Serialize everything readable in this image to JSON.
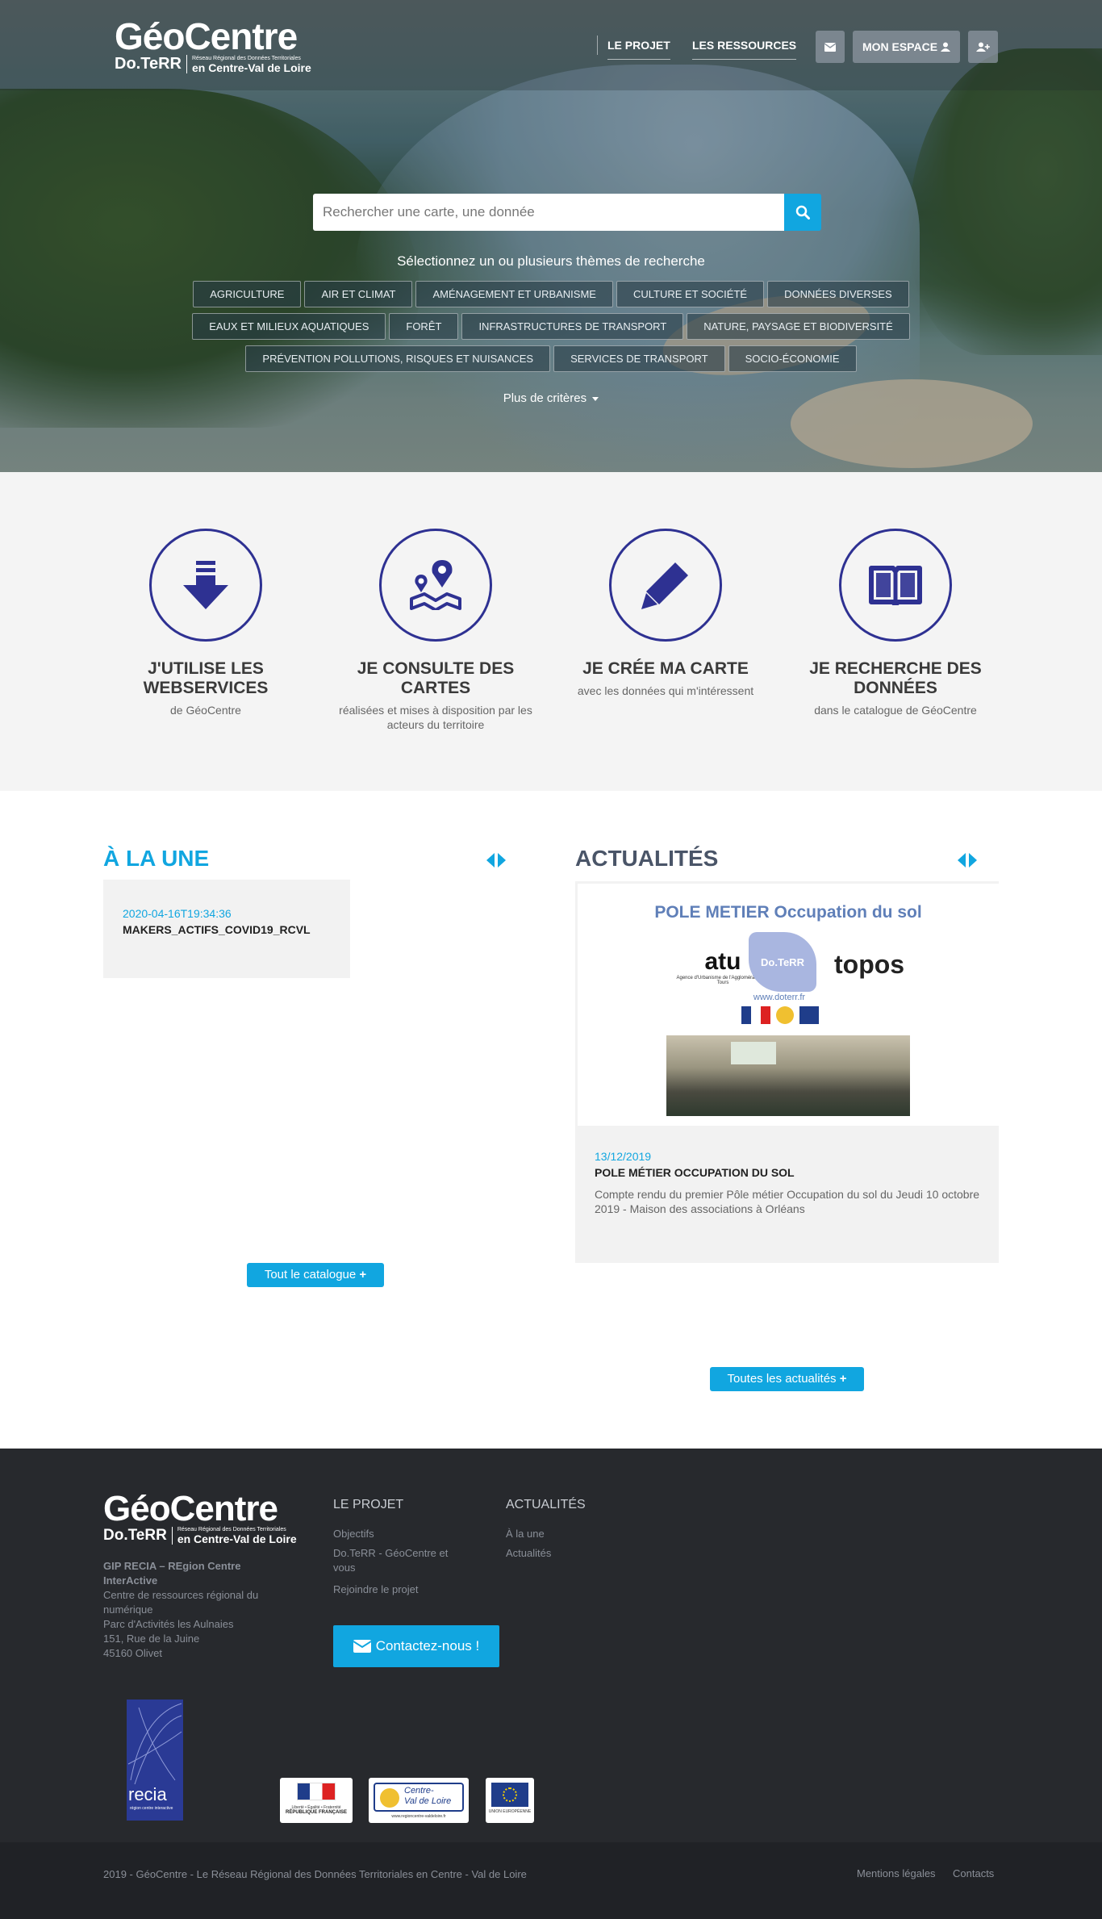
{
  "header": {
    "logo_title": "GéoCentre",
    "logo_brand": "Do.TeRR",
    "logo_tagline": "Réseau Régional des Données Territoriales",
    "logo_region": "en Centre-Val de Loire",
    "nav_projet": "LE PROJET",
    "nav_ressources": "LES RESSOURCES",
    "mon_espace": "MON ESPACE",
    "mail_icon": "envelope-icon",
    "user_icon": "user-icon",
    "adduser_icon": "user-plus-icon"
  },
  "search": {
    "placeholder": "Rechercher une carte, une donnée",
    "icon": "search-icon"
  },
  "themes": {
    "title": "Sélectionnez un ou plusieurs thèmes de recherche",
    "chips": [
      "AGRICULTURE",
      "AIR ET CLIMAT",
      "AMÉNAGEMENT ET URBANISME",
      "CULTURE ET SOCIÉTÉ",
      "DONNÉES DIVERSES",
      "EAUX ET MILIEUX AQUATIQUES",
      "FORÊT",
      "INFRASTRUCTURES DE TRANSPORT",
      "NATURE, PAYSAGE ET BIODIVERSITÉ",
      "PRÉVENTION POLLUTIONS, RISQUES ET NUISANCES",
      "SERVICES DE TRANSPORT",
      "SOCIO-ÉCONOMIE"
    ],
    "more": "Plus de critères"
  },
  "features": [
    {
      "title": "J'UTILISE LES WEBSERVICES",
      "sub": "de GéoCentre",
      "icon": "download-icon"
    },
    {
      "title": "JE CONSULTE DES CARTES",
      "sub": "réalisées et mises à disposition par les acteurs du territoire",
      "icon": "map-pin-icon"
    },
    {
      "title": "JE CRÉE MA CARTE",
      "sub": "avec les données qui m'intéressent",
      "icon": "pencil-icon"
    },
    {
      "title": "JE RECHERCHE DES DONNÉES",
      "sub": "dans le catalogue de GéoCentre",
      "icon": "book-icon"
    }
  ],
  "une": {
    "title": "À LA UNE",
    "date": "2020-04-16T19:34:36",
    "item_title": "MAKERS_ACTIFS_COVID19_RCVL",
    "button": "Tout le catalogue"
  },
  "actualites": {
    "title": "ACTUALITÉS",
    "image_heading": "POLE METIER Occupation du sol",
    "image_logo1": "atu",
    "image_logo1_caption": "Agence d'Urbanisme de l'Agglomération de Tours",
    "image_logo2": "Do.TeRR",
    "image_logo3": "topos",
    "image_url": "www.doterr.fr",
    "date": "13/12/2019",
    "item_title": "POLE MÉTIER OCCUPATION DU SOL",
    "desc": "Compte rendu du premier Pôle métier Occupation du sol du Jeudi 10 octobre 2019 - Maison des associations à Orléans",
    "button": "Toutes les actualités"
  },
  "footer": {
    "logo_title": "GéoCentre",
    "logo_brand": "Do.TeRR",
    "logo_tagline": "Réseau Régional des Données Territoriales",
    "logo_region": "en Centre-Val de Loire",
    "org_name": "GIP RECIA – REgion Centre InterActive",
    "org_line1": "Centre de ressources régional du numérique",
    "org_line2": "Parc d'Activités les Aulnaies",
    "org_line3": "151, Rue de la Juine",
    "org_line4": "45160 Olivet",
    "col1_title": "LE PROJET",
    "col1_links": [
      "Objectifs",
      "Do.TeRR - GéoCentre et vous",
      "Rejoindre le projet"
    ],
    "col2_title": "ACTUALITÉS",
    "col2_links": [
      "À la une",
      "Actualités"
    ],
    "contact": "Contactez-nous !",
    "recia": "recia",
    "recia_sub": "région centre interactive",
    "partner1_a": "Liberté • Égalité • Fraternité",
    "partner1_b": "RÉPUBLIQUE FRANÇAISE",
    "partner2_a": "Centre-",
    "partner2_b": "Val de Loire",
    "partner2_c": "www.regioncentre-valdeloire.fr",
    "partner3": "UNION EUROPÉENNE",
    "copyright": "2019 - GéoCentre - Le Réseau Régional des Données Territoriales en Centre - Val de Loire",
    "mentions": "Mentions légales",
    "contacts": "Contacts"
  },
  "colors": {
    "accent": "#11a6e0",
    "icon_navy": "#2e3192",
    "footer_bg": "#27292d"
  }
}
